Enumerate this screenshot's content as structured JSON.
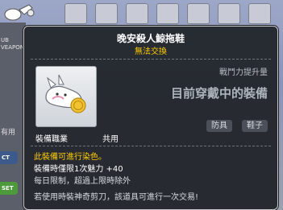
{
  "background": {
    "left_panel_lines": [
      "UB",
      "VEAPON"
    ],
    "left_usage": "有用",
    "left_btn1": "CT",
    "left_btn2": "SET"
  },
  "tooltip": {
    "title": "晚安殺人鯨拖鞋",
    "subtitle": "無法交換",
    "power_label": "戰鬥力提升量",
    "power_status": "目前穿戴中的裝備",
    "tags": [
      "防具",
      "鞋子"
    ],
    "job_label": "裝備職業",
    "job_value": "共用",
    "dye_text": "此裝備可進行染色。",
    "stat_text": "裝備時僅限1次魅力 +40",
    "daily_text": "每日限制，超過上限時除外",
    "scissors_text": "若使用時裝神奇剪刀，該道具可進行一次交易!"
  },
  "colors": {
    "tooltip_bg": "#22262c",
    "gold": "#ffcc00",
    "white": "#ffffff",
    "muted": "#b7bcc4"
  }
}
